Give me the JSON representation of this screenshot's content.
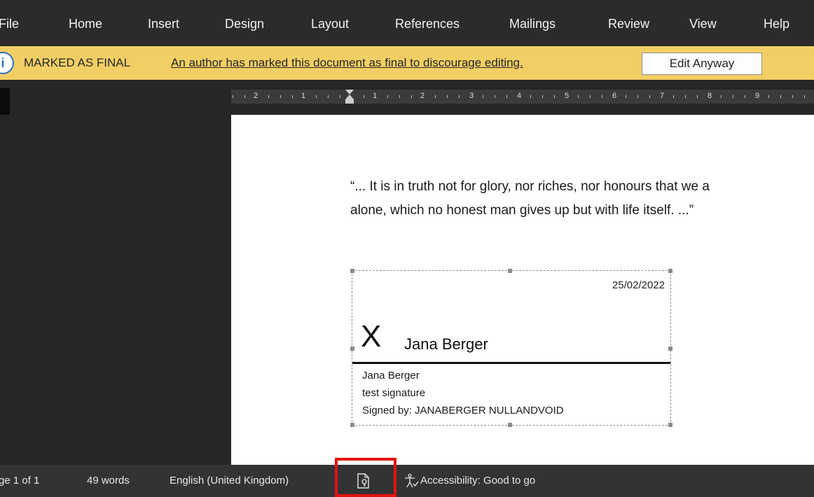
{
  "ribbon": {
    "tabs": [
      "File",
      "Home",
      "Insert",
      "Design",
      "Layout",
      "References",
      "Mailings",
      "Review",
      "View",
      "Help"
    ]
  },
  "message_bar": {
    "info_icon": "i",
    "title": "MARKED AS FINAL",
    "message": "An author has marked this document as final to discourage editing.",
    "button": "Edit Anyway"
  },
  "ruler": {
    "labels": [
      "2",
      "1",
      "1",
      "2",
      "3",
      "4",
      "5",
      "6",
      "7",
      "8",
      "9"
    ]
  },
  "document": {
    "quote_line1": "“... It is in truth not for glory, nor riches, nor honours that we a",
    "quote_line2": "alone, which no honest man gives up but with life itself. ...”",
    "signature": {
      "date": "25/02/2022",
      "x_mark": "X",
      "signer_name": "Jana Berger",
      "printed_name": "Jana Berger",
      "title": "test signature",
      "signed_by": "Signed by: JANABERGER NULLANDVOID"
    }
  },
  "status_bar": {
    "page": "ge 1 of 1",
    "words": "49 words",
    "language": "English (United Kingdom)",
    "accessibility": "Accessibility: Good to go"
  },
  "colors": {
    "ribbon_bg": "#2b2b2b",
    "message_bar_bg": "#f2cf65",
    "workspace_bg": "#262626",
    "status_bg": "#333333",
    "highlight": "#e31212"
  }
}
